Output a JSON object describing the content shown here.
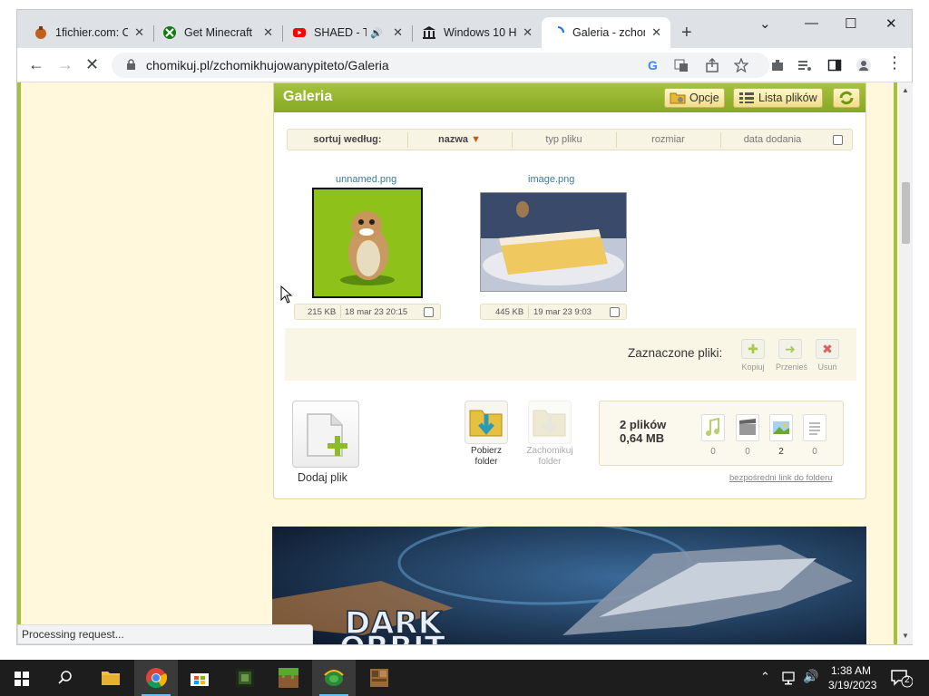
{
  "browser": {
    "tabs": [
      {
        "label": "1fichier.com: C"
      },
      {
        "label": "Get Minecraft"
      },
      {
        "label": "SHAED - T"
      },
      {
        "label": "Windows 10 H"
      },
      {
        "label": "Galeria - zchom"
      }
    ],
    "url": "chomikuj.pl/zchomikhujowanypiteto/Galeria",
    "status_text": "Processing request..."
  },
  "gallery": {
    "title": "Galeria",
    "options_label": "Opcje",
    "list_label": "Lista plików",
    "sort": {
      "label": "sortuj według:",
      "name": "nazwa",
      "type": "typ pliku",
      "size": "rozmiar",
      "date": "data dodania"
    },
    "files": [
      {
        "name": "unnamed.png",
        "size": "215 KB",
        "date": "18 mar 23 20:15"
      },
      {
        "name": "image.png",
        "size": "445 KB",
        "date": "19 mar 23 9:03"
      }
    ],
    "selected": {
      "label": "Zaznaczone pliki:",
      "copy": "Kopiuj",
      "move": "Przenieś",
      "delete": "Usuń"
    },
    "add_file": "Dodaj plik",
    "download_folder": [
      "Pobierz",
      "folder"
    ],
    "save_folder": [
      "Zachomikuj",
      "folder"
    ],
    "stats": {
      "files": "2 plików",
      "size": "0,64 MB",
      "music": "0",
      "video": "0",
      "images": "2",
      "docs": "0"
    },
    "direct_link": "bezpośredni link do folderu"
  },
  "banner": {
    "line1": "DARK",
    "line2": "ORBIT"
  },
  "taskbar": {
    "time": "1:38 AM",
    "date": "3/19/2023",
    "notifications": "2"
  }
}
